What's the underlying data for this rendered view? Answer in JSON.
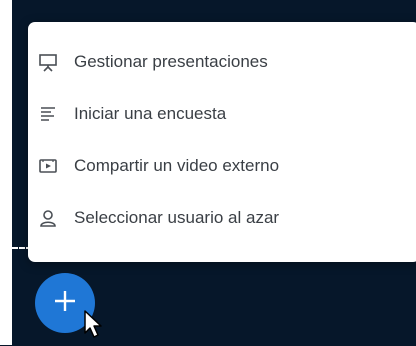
{
  "menu": {
    "items": [
      {
        "label": "Gestionar presentaciones",
        "icon": "presentation-icon"
      },
      {
        "label": "Iniciar una encuesta",
        "icon": "poll-icon"
      },
      {
        "label": "Compartir un video externo",
        "icon": "video-icon"
      },
      {
        "label": "Seleccionar usuario al azar",
        "icon": "user-icon"
      }
    ]
  },
  "fab": {
    "icon": "plus-icon",
    "color": "#1f77d6"
  },
  "colors": {
    "background": "#06172a",
    "menu_bg": "#ffffff",
    "text": "#3a3f45"
  }
}
